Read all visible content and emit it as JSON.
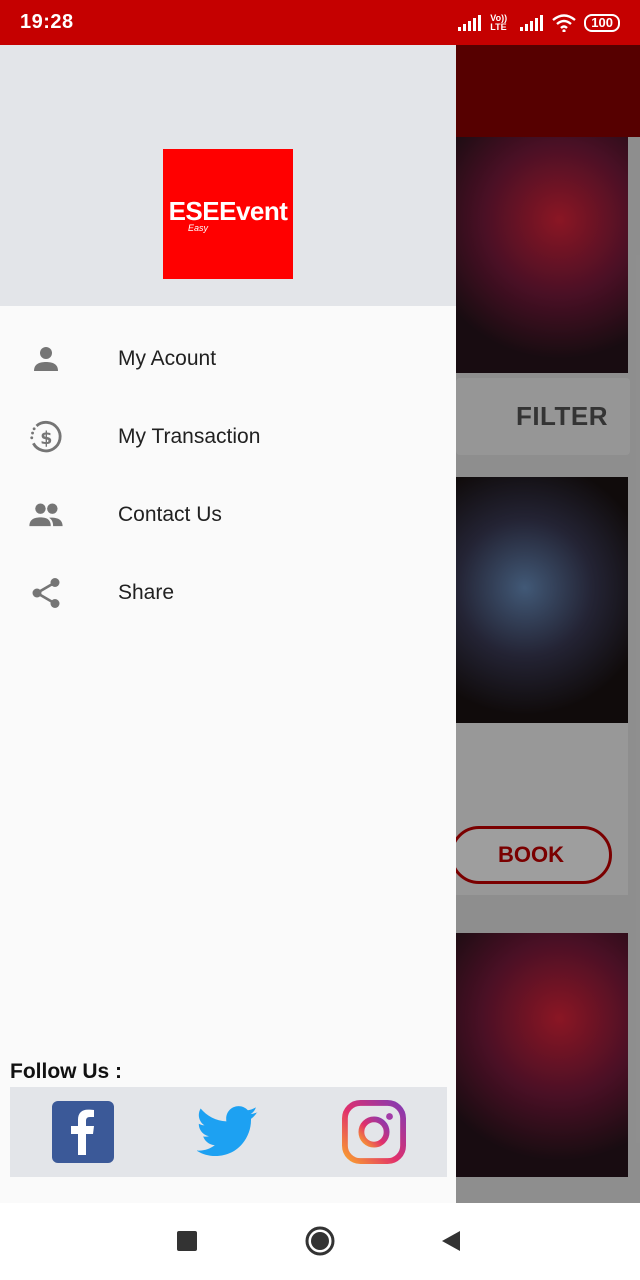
{
  "status_bar": {
    "time": "19:28",
    "volte_label": "Vo)) LTE",
    "battery": "100"
  },
  "background": {
    "filter_label": "FILTER",
    "book_label": "BOOK"
  },
  "drawer": {
    "logo": {
      "text": "ESEEvent",
      "sub": "Easy"
    },
    "menu": [
      {
        "label": "My Acount",
        "icon": "person-icon"
      },
      {
        "label": "My Transaction",
        "icon": "transaction-history-icon"
      },
      {
        "label": "Contact Us",
        "icon": "people-icon"
      },
      {
        "label": "Share",
        "icon": "share-icon"
      }
    ],
    "follow_title": "Follow Us :",
    "social": [
      {
        "name": "facebook",
        "icon": "facebook-icon"
      },
      {
        "name": "twitter",
        "icon": "twitter-icon"
      },
      {
        "name": "instagram",
        "icon": "instagram-icon"
      }
    ]
  },
  "colors": {
    "accent": "#c50000",
    "logo_bg": "#ff0000"
  }
}
